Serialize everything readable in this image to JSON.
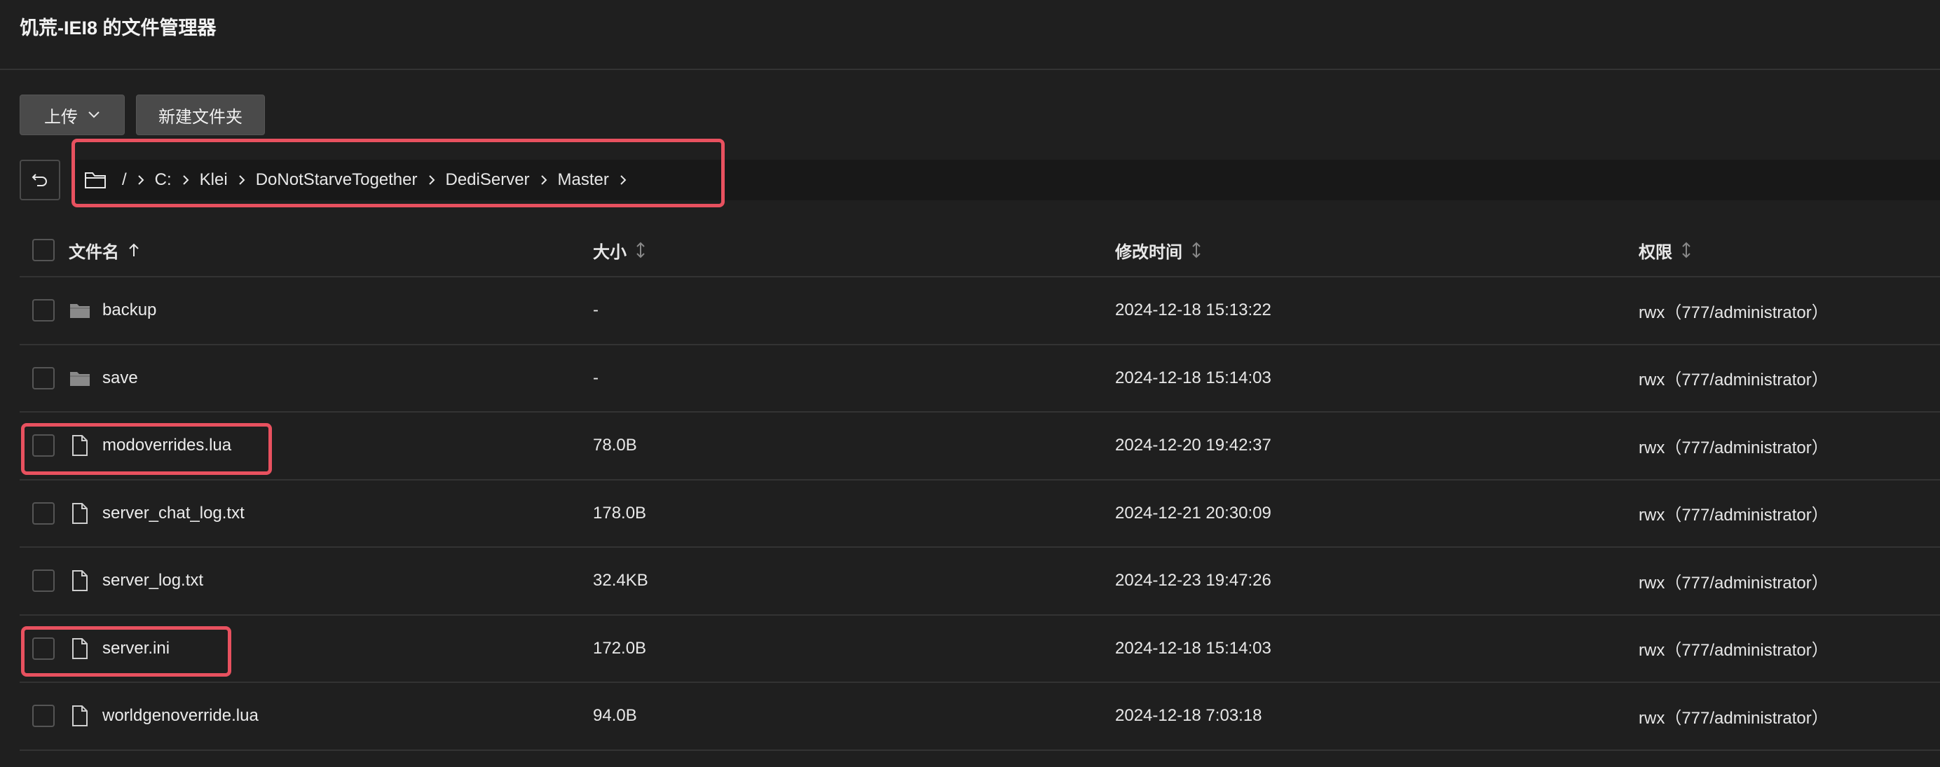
{
  "header": {
    "title": "饥荒-IEI8 的文件管理器"
  },
  "toolbar": {
    "upload_label": "上传",
    "new_folder_label": "新建文件夹"
  },
  "breadcrumb": {
    "root": "/",
    "segments": [
      "C:",
      "Klei",
      "DoNotStarveTogether",
      "DediServer",
      "Master"
    ]
  },
  "table": {
    "columns": {
      "name": "文件名",
      "size": "大小",
      "modified": "修改时间",
      "permissions": "权限"
    },
    "rows": [
      {
        "type": "folder",
        "name": "backup",
        "size": "-",
        "modified": "2024-12-18 15:13:22",
        "permissions": "rwx（777/administrator）"
      },
      {
        "type": "folder",
        "name": "save",
        "size": "-",
        "modified": "2024-12-18 15:14:03",
        "permissions": "rwx（777/administrator）"
      },
      {
        "type": "file",
        "name": "modoverrides.lua",
        "size": "78.0B",
        "modified": "2024-12-20 19:42:37",
        "permissions": "rwx（777/administrator）"
      },
      {
        "type": "file",
        "name": "server_chat_log.txt",
        "size": "178.0B",
        "modified": "2024-12-21 20:30:09",
        "permissions": "rwx（777/administrator）"
      },
      {
        "type": "file",
        "name": "server_log.txt",
        "size": "32.4KB",
        "modified": "2024-12-23 19:47:26",
        "permissions": "rwx（777/administrator）"
      },
      {
        "type": "file",
        "name": "server.ini",
        "size": "172.0B",
        "modified": "2024-12-18 15:14:03",
        "permissions": "rwx（777/administrator）"
      },
      {
        "type": "file",
        "name": "worldgenoverride.lua",
        "size": "94.0B",
        "modified": "2024-12-18 7:03:18",
        "permissions": "rwx（777/administrator）"
      }
    ]
  },
  "colors": {
    "background": "#1f1f1f",
    "highlight": "#e8515f",
    "button": "#4a4a4a"
  }
}
